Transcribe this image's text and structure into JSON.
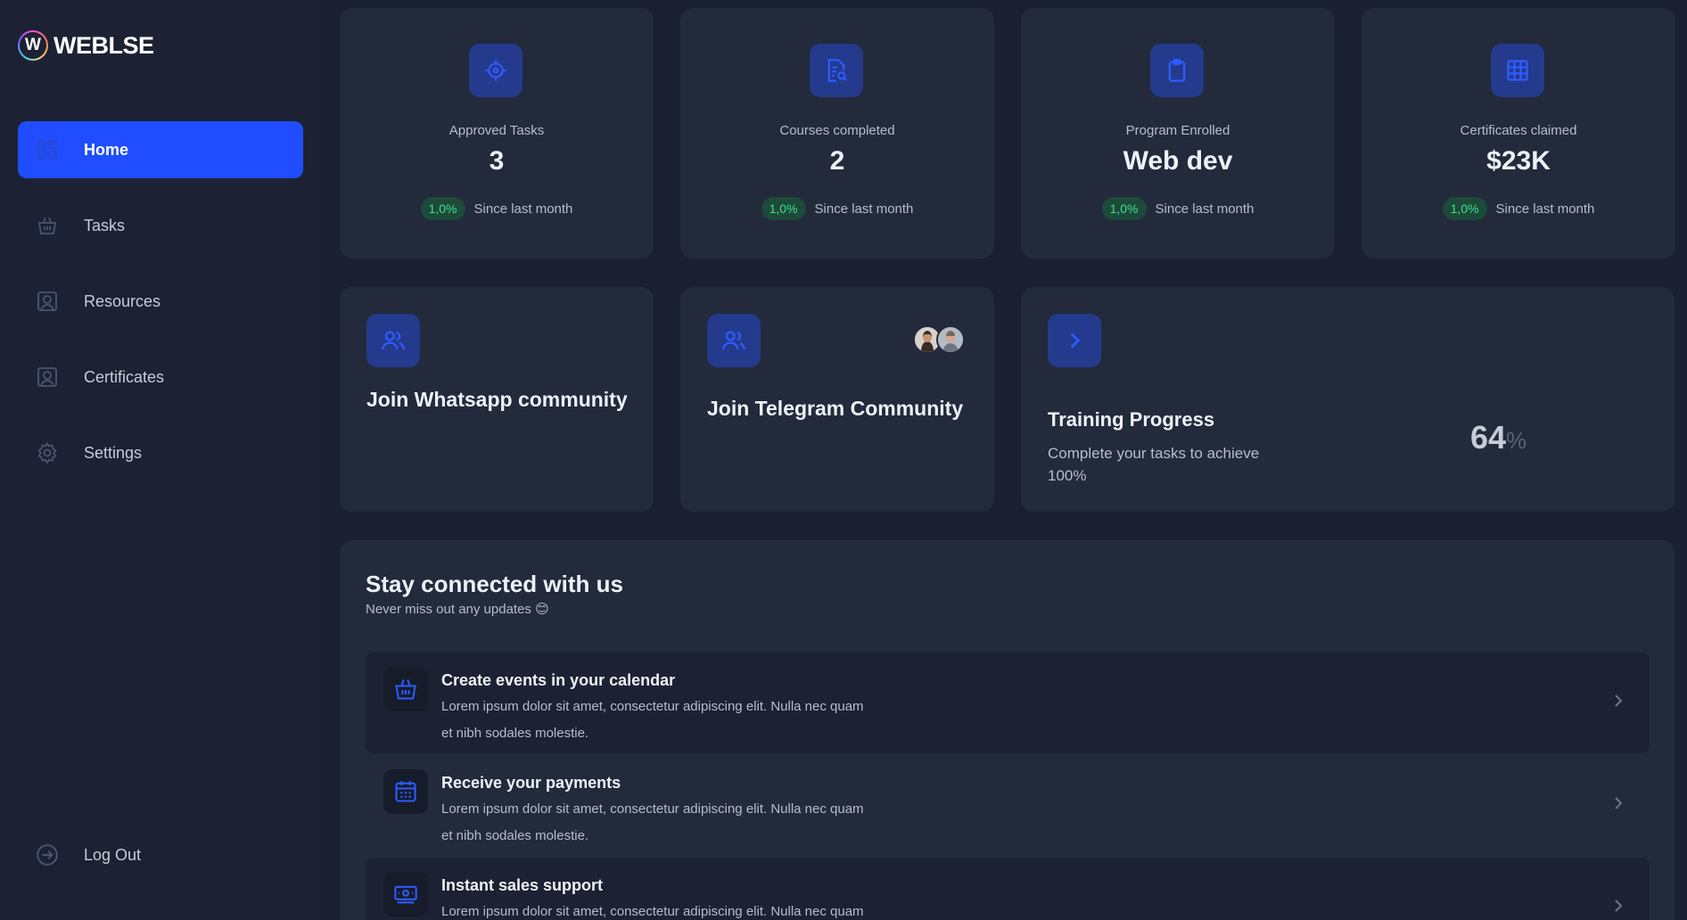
{
  "brand": {
    "logo_letter": "W",
    "name": "WEBLSE"
  },
  "sidebar": {
    "items": [
      {
        "label": "Home",
        "icon": "grid-icon",
        "active": true
      },
      {
        "label": "Tasks",
        "icon": "basket-icon"
      },
      {
        "label": "Resources",
        "icon": "user-square-icon"
      },
      {
        "label": "Certificates",
        "icon": "user-square-icon"
      },
      {
        "label": "Settings",
        "icon": "gear-icon"
      }
    ],
    "logout": {
      "label": "Log Out",
      "icon": "logout-icon"
    }
  },
  "stats": [
    {
      "label": "Approved Tasks",
      "value": "3",
      "badge": "1,0%",
      "note": "Since last month",
      "icon": "target-icon"
    },
    {
      "label": "Courses completed",
      "value": "2",
      "badge": "1,0%",
      "note": "Since last month",
      "icon": "document-search-icon"
    },
    {
      "label": "Program Enrolled",
      "value": "Web dev",
      "badge": "1,0%",
      "note": "Since last month",
      "icon": "clipboard-icon"
    },
    {
      "label": "Certificates claimed",
      "value": "$23K",
      "badge": "1,0%",
      "note": "Since last month",
      "icon": "table-icon"
    }
  ],
  "community": {
    "whatsapp": {
      "title": "Join Whatsapp community",
      "icon": "users-icon"
    },
    "telegram": {
      "title": "Join Telegram Community",
      "icon": "users-icon"
    }
  },
  "progress": {
    "title": "Training Progress",
    "subtitle": "Complete your tasks to achieve 100%",
    "value": "64",
    "unit": "%",
    "icon": "chevron-right-icon"
  },
  "connect": {
    "title": "Stay connected with us",
    "subtitle": "Never miss out any updates 😊",
    "items": [
      {
        "title": "Create events in your calendar",
        "desc": "Lorem ipsum dolor sit amet, consectetur adipiscing elit. Nulla nec quam et nibh sodales molestie.",
        "icon": "basket-icon"
      },
      {
        "title": "Receive your payments",
        "desc": "Lorem ipsum dolor sit amet, consectetur adipiscing elit. Nulla nec quam et nibh sodales molestie.",
        "icon": "calendar-icon"
      },
      {
        "title": "Instant sales support",
        "desc": "Lorem ipsum dolor sit amet, consectetur adipiscing elit. Nulla nec quam et nibh sodales molestie.",
        "icon": "money-icon"
      }
    ]
  },
  "colors": {
    "accent": "#1f4dff",
    "badge_bg": "#1d4a3a",
    "badge_text": "#3ee08a",
    "card": "#222a3c",
    "page": "#1a2030"
  }
}
